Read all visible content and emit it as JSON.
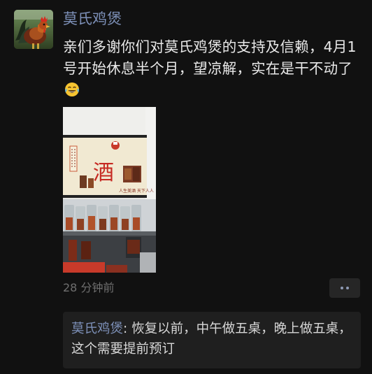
{
  "post": {
    "author": "莫氏鸡煲",
    "avatar_icon": "rooster-avatar",
    "text": "亲们多谢你们对莫氏鸡煲的支持及信赖，4月1号开始休息半个月，望凉解，实在是干不动了",
    "emoji_icon": "tears-of-joy-emoji-icon",
    "photo": {
      "sign_character": "酒",
      "sign_bottom_text": "人生美酒  天下人人"
    },
    "time": "28 分钟前"
  },
  "comments": [
    {
      "name": "莫氏鸡煲",
      "separator": ": ",
      "text": "恢复以前，中午做五桌，晚上做五桌，这个需要提前预订"
    }
  ],
  "colors": {
    "background": "#111111",
    "name_link": "#7d90b8",
    "body_text": "#e9e9e9",
    "meta_text": "#6f6f6f",
    "comment_bg": "#1f1f1f"
  }
}
